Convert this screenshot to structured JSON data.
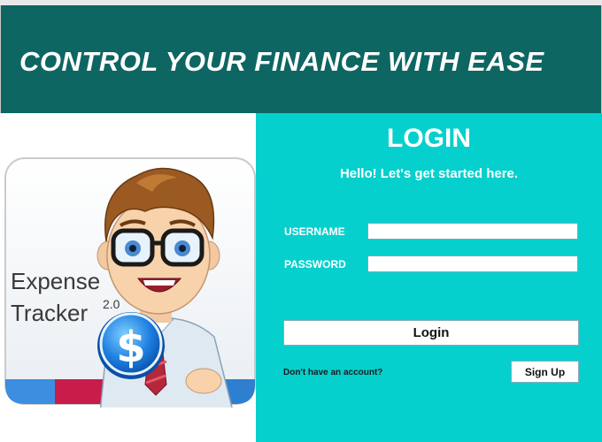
{
  "header": {
    "title": "CONTROL YOUR FINANCE WITH EASE"
  },
  "logo": {
    "line1": "Expense",
    "line2": "Tracker",
    "version": "2.0",
    "badge_symbol": "$"
  },
  "login": {
    "title": "LOGIN",
    "subtitle": "Hello! Let's get started here.",
    "username_label": "USERNAME",
    "username_value": "",
    "password_label": "PASSWORD",
    "password_value": "",
    "login_button": "Login",
    "no_account_text": "Don't have an account?",
    "signup_button": "Sign Up"
  },
  "colors": {
    "header_bg": "#0e6663",
    "panel_bg": "#06d0cd",
    "logo_stripes": [
      "#3c8ee0",
      "#c81c4a",
      "#0f6b5c",
      "#ffffff",
      "#2e7fd0"
    ]
  }
}
